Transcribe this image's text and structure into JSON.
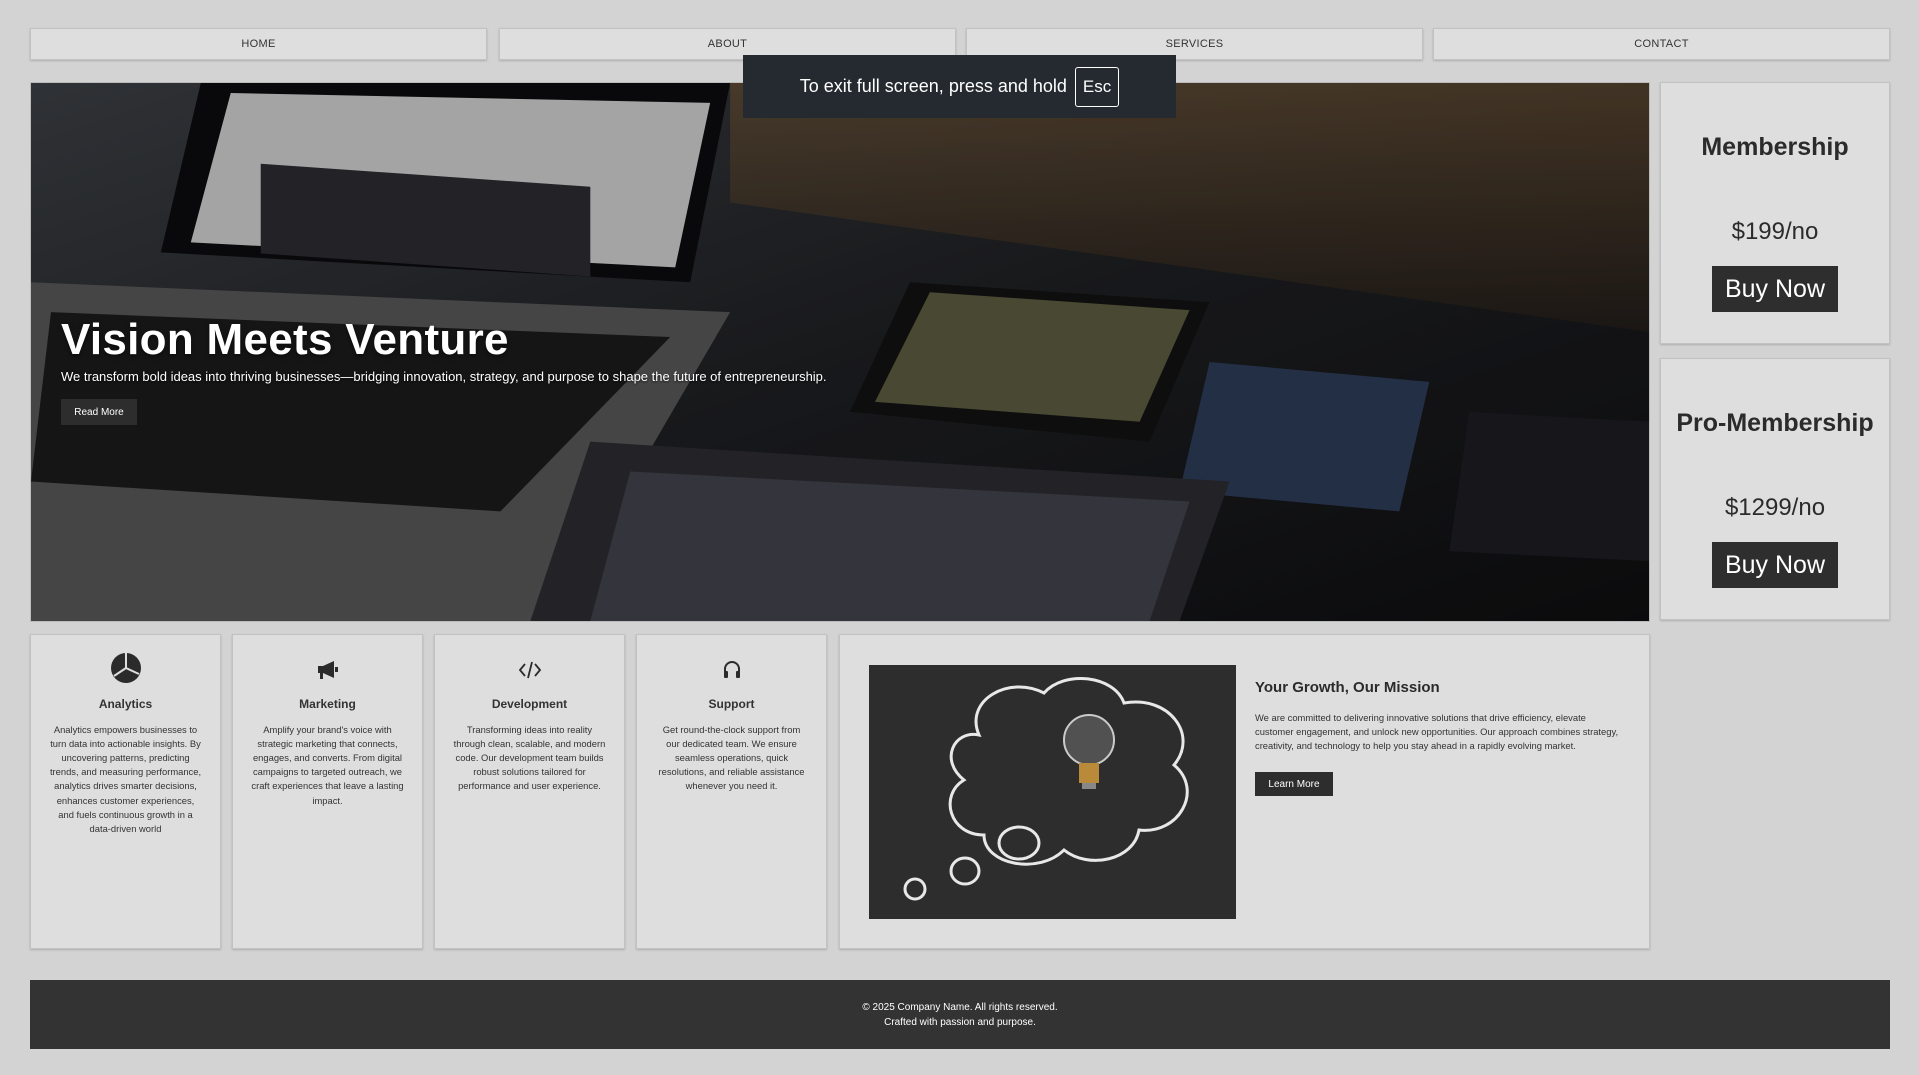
{
  "nav": {
    "items": [
      {
        "label": "HOME"
      },
      {
        "label": "ABOUT"
      },
      {
        "label": "SERVICES"
      },
      {
        "label": "CONTACT"
      }
    ]
  },
  "fullscreen_notice": {
    "text": "To exit full screen, press and hold",
    "key": "Esc"
  },
  "hero": {
    "title": "Vision Meets Venture",
    "subtitle": "We transform bold ideas into thriving businesses—bridging innovation, strategy, and purpose to shape the future of entrepreneurship.",
    "button_label": "Read More"
  },
  "memberships": [
    {
      "title": "Membership",
      "price": "$199/no",
      "button_label": "Buy Now"
    },
    {
      "title": "Pro-Membership",
      "price": "$1299/no",
      "button_label": "Buy Now"
    }
  ],
  "services": [
    {
      "icon": "pie-chart-icon",
      "title": "Analytics",
      "description": "Analytics empowers businesses to turn data into actionable insights. By uncovering patterns, predicting trends, and measuring performance, analytics drives smarter decisions, enhances customer experiences, and fuels continuous growth in a data-driven world"
    },
    {
      "icon": "megaphone-icon",
      "title": "Marketing",
      "description": "Amplify your brand's voice with strategic marketing that connects, engages, and converts. From digital campaigns to targeted outreach, we craft experiences that leave a lasting impact."
    },
    {
      "icon": "code-icon",
      "title": "Development",
      "description": "Transforming ideas into reality through clean, scalable, and modern code. Our development team builds robust solutions tailored for performance and user experience."
    },
    {
      "icon": "headset-icon",
      "title": "Support",
      "description": "Get round-the-clock support from our dedicated team. We ensure seamless operations, quick resolutions, and reliable assistance whenever you need it."
    }
  ],
  "mission": {
    "title": "Your Growth, Our Mission",
    "text": "We are committed to delivering innovative solutions that drive efficiency, elevate customer engagement, and unlock new opportunities. Our approach combines strategy, creativity, and technology to help you stay ahead in a rapidly evolving market.",
    "button_label": "Learn More"
  },
  "footer": {
    "line1": "© 2025 Company Name. All rights reserved.",
    "line2": "Crafted with passion and purpose."
  }
}
